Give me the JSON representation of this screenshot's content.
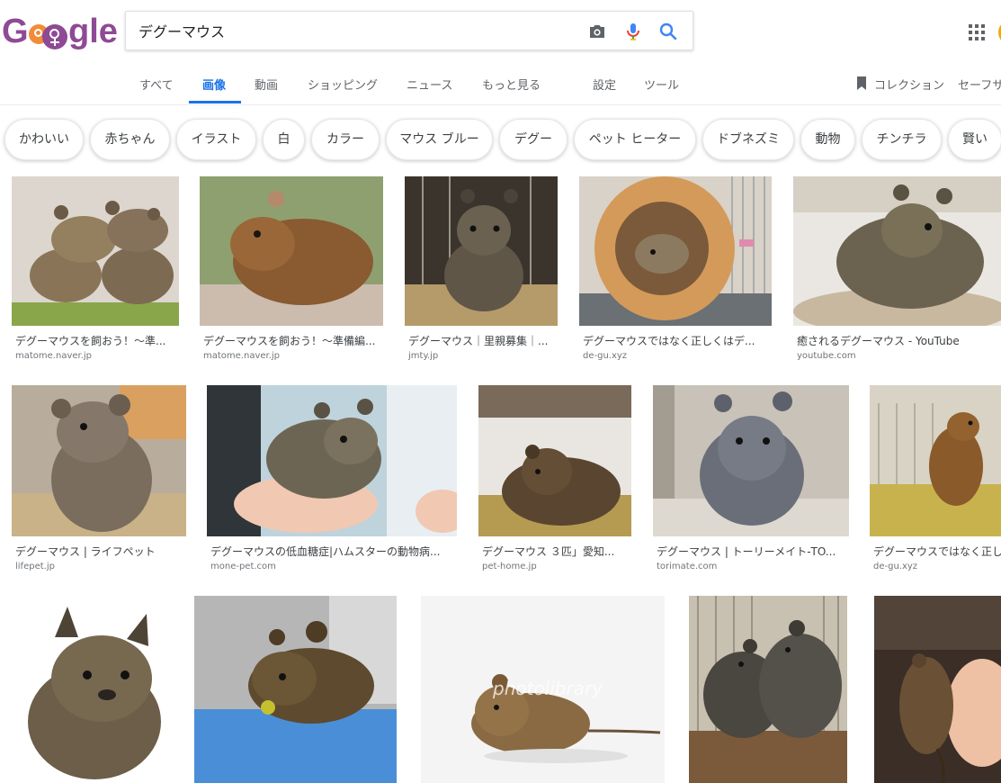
{
  "logo": {
    "text_left": "G",
    "text_right": "gle"
  },
  "search": {
    "query": "デグーマウス"
  },
  "tabs": [
    {
      "label": "すべて",
      "active": false
    },
    {
      "label": "画像",
      "active": true
    },
    {
      "label": "動画",
      "active": false
    },
    {
      "label": "ショッピング",
      "active": false
    },
    {
      "label": "ニュース",
      "active": false
    },
    {
      "label": "もっと見る",
      "active": false
    },
    {
      "label": "設定",
      "active": false
    },
    {
      "label": "ツール",
      "active": false
    },
    {
      "label": "コレクション",
      "active": false
    },
    {
      "label": "セーフサ",
      "active": false
    }
  ],
  "chips": [
    "かわいい",
    "赤ちゃん",
    "イラスト",
    "白",
    "カラー",
    "マウス ブルー",
    "デグー",
    "ペット ヒーター",
    "ドブネズミ",
    "動物",
    "チンチラ",
    "賢い"
  ],
  "results": [
    {
      "title": "デグーマウスを飼おう！〜準...",
      "source": "matome.naver.jp",
      "watermark": ""
    },
    {
      "title": "デグーマウスを飼おう！〜準備編...",
      "source": "matome.naver.jp",
      "watermark": ""
    },
    {
      "title": "デグーマウス｜里親募集｜...",
      "source": "jmty.jp",
      "watermark": ""
    },
    {
      "title": "デグーマウスではなく正しくはデ...",
      "source": "de-gu.xyz",
      "watermark": ""
    },
    {
      "title": "癒されるデグーマウス - YouTube",
      "source": "youtube.com",
      "watermark": ""
    },
    {
      "title": "デグーマウス | ライフペット",
      "source": "lifepet.jp",
      "watermark": ""
    },
    {
      "title": "デグーマウスの低血糖症|ハムスターの動物病...",
      "source": "mone-pet.com",
      "watermark": ""
    },
    {
      "title": "デグーマウス ３匹」愛知...",
      "source": "pet-home.jp",
      "watermark": ""
    },
    {
      "title": "デグーマウス | トーリーメイト-TO...",
      "source": "torimate.com",
      "watermark": ""
    },
    {
      "title": "デグーマウスではなく正し",
      "source": "de-gu.xyz",
      "watermark": ""
    },
    {
      "title": "",
      "source": "",
      "watermark": ""
    },
    {
      "title": "",
      "source": "",
      "watermark": ""
    },
    {
      "title": "",
      "source": "",
      "watermark": "photolibrary"
    },
    {
      "title": "",
      "source": "",
      "watermark": ""
    },
    {
      "title": "",
      "source": "",
      "watermark": ""
    }
  ],
  "colors": {
    "accent": "#1a73e8",
    "logo": "#8e4a94",
    "logo_orange": "#f28b3a"
  }
}
